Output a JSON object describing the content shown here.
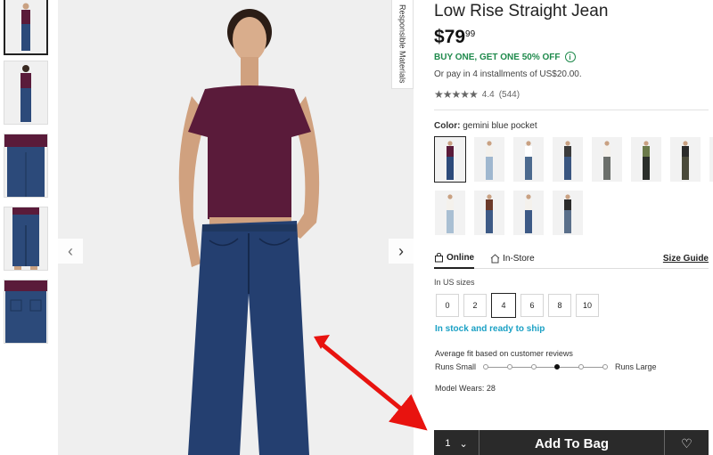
{
  "product": {
    "title": "Low Rise Straight Jean",
    "price_main": "$79",
    "price_cents": "99",
    "promo": "BUY ONE, GET ONE 50% OFF",
    "installments": "Or pay in 4 installments of US$20.00.",
    "rating_stars": "★★★★★",
    "rating_value": "4.4",
    "rating_count": "(544)"
  },
  "gallery": {
    "responsible_tab": "Responsible Materials",
    "prev_arrow": "‹",
    "next_arrow": "›",
    "thumb_count": 5
  },
  "color": {
    "label": "Color:",
    "selected": "gemini blue pocket",
    "swatch_tops": [
      "#5a1b3a",
      "#f4f1ec",
      "#ffffff",
      "#3b3b3b",
      "#f4f1ec",
      "#6b7a4a",
      "#2b2b2b",
      "#f4f1ec",
      "#f4f1ec",
      "#6b3a2a",
      "#f4f1ec",
      "#2b2b2b"
    ],
    "swatch_bottoms": [
      "#2c4a7a",
      "#9fb7cf",
      "#4c6a8e",
      "#3a5680",
      "#6b6f6b",
      "#2b2f2b",
      "#4a4a3a",
      "#6b7a4a",
      "#a9bfd3",
      "#3d5a86",
      "#3d5a86",
      "#5a6f8a"
    ]
  },
  "tabs": {
    "online": "Online",
    "instore": "In-Store",
    "size_guide": "Size Guide"
  },
  "sizes": {
    "label": "In US sizes",
    "options": [
      "0",
      "2",
      "4",
      "6",
      "8",
      "10"
    ],
    "selected": "4"
  },
  "stock": "In stock and ready to ship",
  "fit": {
    "title": "Average fit based on customer reviews",
    "left": "Runs Small",
    "right": "Runs Large",
    "selected_index": 3,
    "points": 6
  },
  "model_wears": "Model Wears: 28",
  "bag": {
    "qty": "1",
    "qty_chevron": "⌄",
    "add_label": "Add To Bag",
    "wish_icon": "♡"
  },
  "colors": {
    "accent_green": "#1f8a4c",
    "stock_blue": "#1aa0c4",
    "button_dark": "#2a2a2a",
    "annotation_red": "#e8130f"
  }
}
